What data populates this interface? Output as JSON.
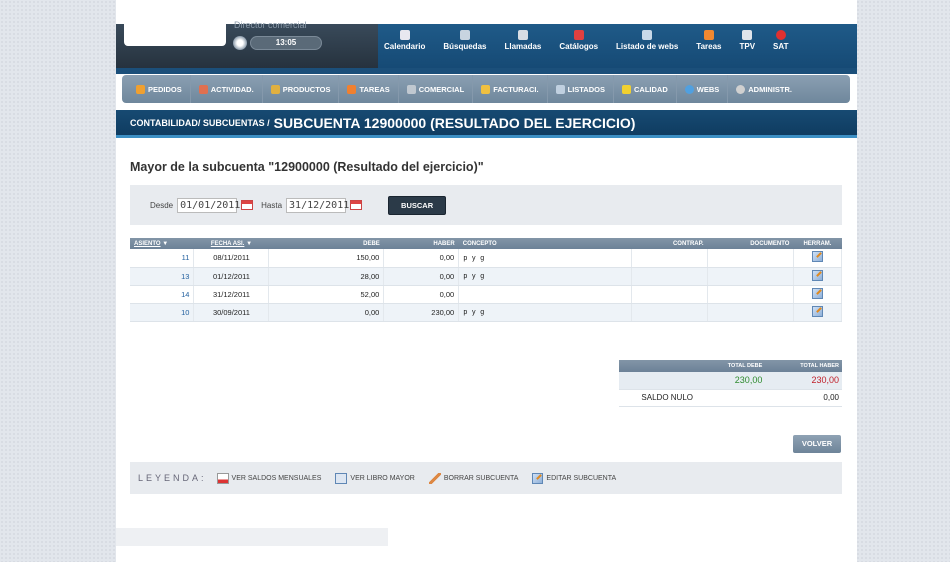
{
  "header": {
    "role_text": "Director comercial",
    "time": "13:05",
    "nav": [
      {
        "label": "Calendario",
        "icon": "calendar-icon"
      },
      {
        "label": "Búsquedas",
        "icon": "search-icon"
      },
      {
        "label": "Llamadas",
        "icon": "phone-icon"
      },
      {
        "label": "Catálogos",
        "icon": "pdf-icon"
      },
      {
        "label": "Listado de webs",
        "icon": "web-icon"
      },
      {
        "label": "Tareas",
        "icon": "tasks-icon"
      },
      {
        "label": "TPV",
        "icon": "tpv-icon"
      },
      {
        "label": "SAT",
        "icon": "sat-icon"
      }
    ]
  },
  "menu": [
    {
      "label": "PEDIDOS",
      "color": "#f0a030"
    },
    {
      "label": "ACTIVIDAD.",
      "color": "#e07050"
    },
    {
      "label": "PRODUCTOS",
      "color": "#e0b040"
    },
    {
      "label": "TAREAS",
      "color": "#f08030"
    },
    {
      "label": "COMERCIAL",
      "color": "#c0c8d0"
    },
    {
      "label": "FACTURACI.",
      "color": "#f0c040"
    },
    {
      "label": "LISTADOS",
      "color": "#c0d0e0"
    },
    {
      "label": "CALIDAD",
      "color": "#f0d030"
    },
    {
      "label": "WEBS",
      "color": "#50a0e0"
    },
    {
      "label": "ADMINISTR.",
      "color": "#d0d0d0"
    }
  ],
  "breadcrumb": "CONTABILIDAD/ SUBCUENTAS /",
  "page_title": "SUBCUENTA 12900000 (RESULTADO DEL EJERCICIO)",
  "heading": "Mayor de la subcuenta \"12900000 (Resultado del ejercicio)\"",
  "filter": {
    "desde_label": "Desde",
    "desde_value": "01/01/2011",
    "hasta_label": "Hasta",
    "hasta_value": "31/12/2011",
    "search_button": "BUSCAR"
  },
  "table": {
    "headers": {
      "asiento": "ASIENTO",
      "fecha": "FECHA ASI.",
      "debe": "DEBE",
      "haber": "HABER",
      "concepto": "CONCEPTO",
      "contrap": "CONTRAP.",
      "documento": "DOCUMENTO",
      "herram": "HERRAM."
    },
    "rows": [
      {
        "asiento": "11",
        "fecha": "08/11/2011",
        "debe": "150,00",
        "haber": "0,00",
        "concepto": "p y g"
      },
      {
        "asiento": "13",
        "fecha": "01/12/2011",
        "debe": "28,00",
        "haber": "0,00",
        "concepto": "p y g"
      },
      {
        "asiento": "14",
        "fecha": "31/12/2011",
        "debe": "52,00",
        "haber": "0,00",
        "concepto": ""
      },
      {
        "asiento": "10",
        "fecha": "30/09/2011",
        "debe": "0,00",
        "haber": "230,00",
        "concepto": "p y g"
      }
    ]
  },
  "totals": {
    "total_debe_label": "TOTAL DEBE",
    "total_haber_label": "TOTAL HABER",
    "total_debe": "230,00",
    "total_haber": "230,00",
    "saldo_label": "SALDO NULO",
    "saldo_value": "0,00",
    "debe_color": "#2e8b2e",
    "haber_color": "#c0202a"
  },
  "volver_button": "VOLVER",
  "legend": {
    "title": "LEYENDA:",
    "items": [
      {
        "label": "VER SALDOS MENSUALES",
        "icon": "monthly-balance-icon"
      },
      {
        "label": "VER LIBRO MAYOR",
        "icon": "ledger-icon"
      },
      {
        "label": "BORRAR SUBCUENTA",
        "icon": "delete-icon"
      },
      {
        "label": "EDITAR SUBCUENTA",
        "icon": "edit-icon"
      }
    ]
  }
}
